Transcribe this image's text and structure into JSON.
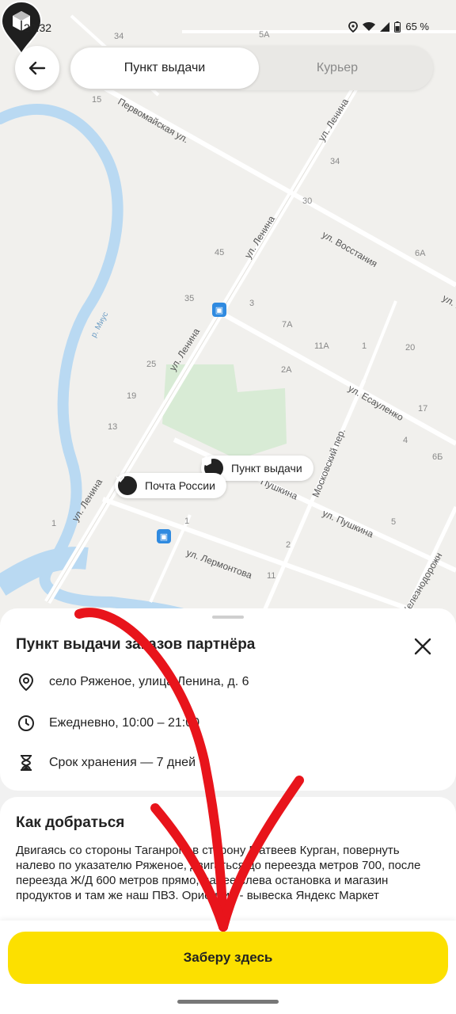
{
  "status_bar": {
    "time": "20:32",
    "battery": "65 %"
  },
  "header": {
    "tabs": [
      {
        "label": "Пункт выдачи",
        "active": true
      },
      {
        "label": "Курьер",
        "active": false
      }
    ]
  },
  "map": {
    "streets": [
      "Первомайская ул.",
      "ул. Ленина",
      "ул. Ленина",
      "ул. Ленина",
      "ул. Ленина",
      "ул. Восстания",
      "ул. Во",
      "ул. Есауленко",
      "Московский пер.",
      "ул. Пушкина",
      "Пушкина",
      "ул. Лермонтова",
      "Железнодорожн",
      "р. Миус"
    ],
    "house_numbers": [
      "34",
      "5A",
      "15",
      "34",
      "30",
      "6A",
      "45",
      "35",
      "3",
      "7A",
      "11A",
      "1",
      "20",
      "25",
      "2A",
      "19",
      "17",
      "13",
      "4",
      "6Б",
      "1",
      "1",
      "5",
      "2",
      "11"
    ],
    "markers": {
      "pickup_chip": "Пункт выдачи",
      "post_chip": "Почта России"
    }
  },
  "sheet": {
    "title": "Пункт выдачи заказов партнёра",
    "address": "село Ряженое, улица Ленина, д. 6",
    "hours": "Ежедневно, 10:00 – 21:00",
    "storage": "Срок хранения — 7 дней",
    "route_title": "Как добраться",
    "route_text": "Двигаясь со стороны Таганрога в сторону Матвеев Курган, повернуть налево по указателю Ряженое, двигаться до переезда метров 700, после переезда Ж/Д 600 метров прямо, далее слева остановка и магазин продуктов и там же наш ПВЗ. Ориентир - вывеска Яндекс Маркет",
    "confirm_label": "Заберу здесь"
  },
  "colors": {
    "accent": "#fce000",
    "annotation": "#e8141b"
  },
  "icons": [
    "back-arrow-icon",
    "close-icon",
    "location-pin-icon",
    "clock-icon",
    "hourglass-icon",
    "box-icon",
    "post-icon",
    "bus-stop-icon",
    "wifi-icon",
    "signal-icon",
    "battery-icon"
  ]
}
